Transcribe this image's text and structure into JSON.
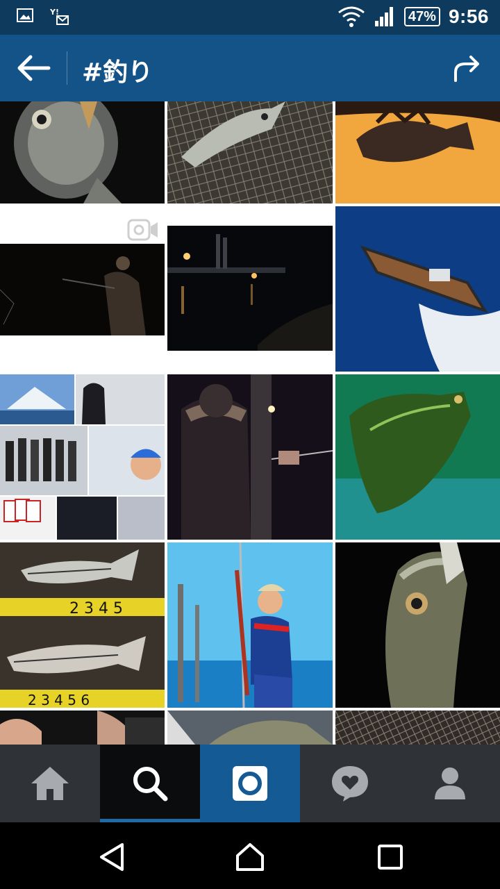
{
  "status_bar": {
    "battery": "47%",
    "time": "9:56",
    "icons": [
      "image-icon",
      "yahoo-mail-icon",
      "wifi-icon",
      "signal-icon",
      "battery-icon"
    ]
  },
  "app_bar": {
    "title": "#釣り",
    "back_icon": "back-arrow-icon",
    "share_icon": "share-icon"
  },
  "grid": {
    "video_badge_icon": "video-camera-icon",
    "tiles": [
      {
        "name": "photo-seabass-night-closeup"
      },
      {
        "name": "photo-fish-in-net"
      },
      {
        "name": "photo-rockfish-orange"
      },
      {
        "name": "video-night-fishing-man"
      },
      {
        "name": "photo-night-harbor-lights"
      },
      {
        "name": "photo-speedboat"
      },
      {
        "name": "photo-collage-mount-fuji-friends"
      },
      {
        "name": "photo-night-angler-jacket"
      },
      {
        "name": "photo-green-bass"
      },
      {
        "name": "photo-seabass-measure"
      },
      {
        "name": "photo-boat-fishing-catch"
      },
      {
        "name": "photo-seabass-dark"
      },
      {
        "name": "photo-hand-fish-partial"
      },
      {
        "name": "photo-boat-deck-partial"
      },
      {
        "name": "photo-net-partial"
      }
    ]
  },
  "tab_bar": {
    "tabs": [
      "home",
      "search",
      "camera",
      "activity",
      "profile"
    ],
    "colors": {
      "bar": "#2f3338",
      "active": "#0b0c0d",
      "camera": "#145a94",
      "indicator": "#1e6ba8"
    }
  },
  "nav_bar": {
    "buttons": [
      "back",
      "home",
      "recents"
    ]
  },
  "colors": {
    "status_bar": "#0e3a5e",
    "app_bar": "#135388"
  }
}
